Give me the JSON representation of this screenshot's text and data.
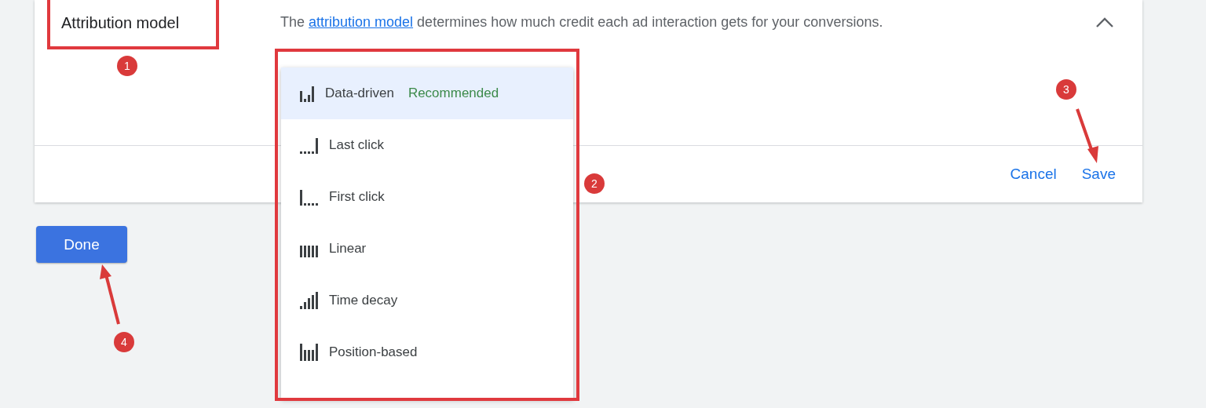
{
  "card": {
    "title": "Attribution model",
    "description": {
      "before": "The ",
      "link": "attribution model",
      "after": " determines how much credit each ad interaction gets for your conversions."
    },
    "expanded": true,
    "actions": [
      "Cancel",
      "Save"
    ]
  },
  "dropdown": {
    "options": [
      {
        "kind": "data_driven",
        "label": "Data-driven",
        "badge": "Recommended",
        "selected": true
      },
      {
        "kind": "last_click",
        "label": "Last click",
        "selected": false
      },
      {
        "kind": "first_click",
        "label": "First click",
        "selected": false
      },
      {
        "kind": "linear",
        "label": "Linear",
        "selected": false
      },
      {
        "kind": "time_decay",
        "label": "Time decay",
        "selected": false
      },
      {
        "kind": "position_based",
        "label": "Position-based",
        "selected": false
      }
    ]
  },
  "done_button": "Done",
  "callouts": [
    {
      "number": "1"
    },
    {
      "number": "2"
    },
    {
      "number": "3"
    },
    {
      "number": "4"
    }
  ]
}
